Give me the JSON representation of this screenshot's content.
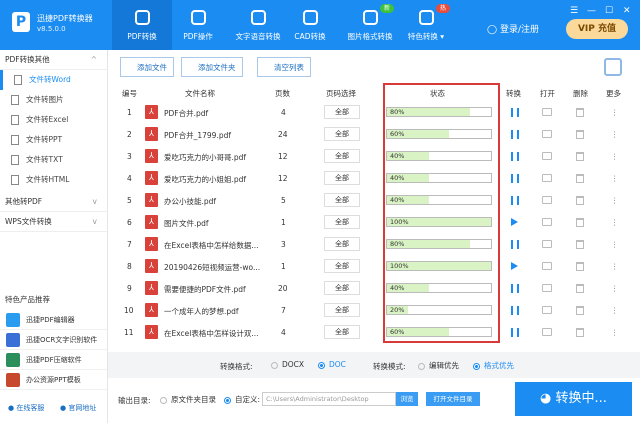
{
  "app": {
    "name": "迅捷PDF转换器",
    "version": "v8.5.0.0"
  },
  "nav": [
    {
      "label": "PDF转换",
      "icon": "convert-icon"
    },
    {
      "label": "PDF操作",
      "icon": "disc-icon"
    },
    {
      "label": "文字语音转换",
      "icon": "audio-icon"
    },
    {
      "label": "CAD转换",
      "icon": "cad-icon"
    },
    {
      "label": "图片格式转换",
      "icon": "image-icon",
      "badge": "新"
    },
    {
      "label": "特色转换 ▾",
      "icon": "star-icon",
      "badge": "热"
    }
  ],
  "header": {
    "login": "登录/注册",
    "vip": "VIP 充值",
    "menu": "☰",
    "minimize": "—",
    "maximize": "☐",
    "close": "✕"
  },
  "sidebar": {
    "group1": "PDF转换其他",
    "items": [
      "文件转Word",
      "文件转图片",
      "文件转Excel",
      "文件转PPT",
      "文件转TXT",
      "文件转HTML"
    ],
    "group2": "其他转PDF",
    "group3": "WPS文件转换",
    "featured_title": "特色产品推荐",
    "products": [
      "迅捷PDF编辑器",
      "迅捷OCR文字识别软件",
      "迅捷PDF压缩软件",
      "办公资源PPT模板"
    ],
    "service": "在线客服",
    "website": "官网地址"
  },
  "toolbar": {
    "add_file": "添加文件",
    "add_folder": "添加文件夹",
    "clear": "清空列表"
  },
  "table": {
    "headers": {
      "index": "编号",
      "name": "文件名称",
      "pages": "页数",
      "range": "页码选择",
      "status": "状态",
      "convert": "转换",
      "open": "打开",
      "delete": "删除",
      "more": "更多"
    },
    "rows": [
      {
        "index": "1",
        "name": "PDF合并.pdf",
        "pages": "4",
        "range": "全部",
        "progress": 80,
        "label": "80%",
        "state": "pause"
      },
      {
        "index": "2",
        "name": "PDF合并_1799.pdf",
        "pages": "24",
        "range": "全部",
        "progress": 60,
        "label": "60%",
        "state": "pause"
      },
      {
        "index": "3",
        "name": "爱吃巧克力的小哥哥.pdf",
        "pages": "12",
        "range": "全部",
        "progress": 40,
        "label": "40%",
        "state": "pause"
      },
      {
        "index": "4",
        "name": "爱吃巧克力的小姐姐.pdf",
        "pages": "12",
        "range": "全部",
        "progress": 40,
        "label": "40%",
        "state": "pause"
      },
      {
        "index": "5",
        "name": "办公小技能.pdf",
        "pages": "5",
        "range": "全部",
        "progress": 40,
        "label": "40%",
        "state": "pause"
      },
      {
        "index": "6",
        "name": "图片文件.pdf",
        "pages": "1",
        "range": "全部",
        "progress": 100,
        "label": "100%",
        "state": "play"
      },
      {
        "index": "7",
        "name": "在Excel表格中怎样给数据...",
        "pages": "3",
        "range": "全部",
        "progress": 80,
        "label": "80%",
        "state": "pause"
      },
      {
        "index": "8",
        "name": "20190426短视频运营-wo...",
        "pages": "1",
        "range": "全部",
        "progress": 100,
        "label": "100%",
        "state": "play"
      },
      {
        "index": "9",
        "name": "需要便捷的PDF文件.pdf",
        "pages": "20",
        "range": "全部",
        "progress": 40,
        "label": "40%",
        "state": "pause"
      },
      {
        "index": "10",
        "name": "一个成年人的梦想.pdf",
        "pages": "7",
        "range": "全部",
        "progress": 20,
        "label": "20%",
        "state": "pause"
      },
      {
        "index": "11",
        "name": "在Excel表格中怎样设计双...",
        "pages": "4",
        "range": "全部",
        "progress": 60,
        "label": "60%",
        "state": "pause"
      }
    ]
  },
  "options": {
    "format_label": "转换格式:",
    "docx": "DOCX",
    "doc": "DOC",
    "format_selected": "DOC",
    "mode_label": "转换模式:",
    "edit_first": "编辑优先",
    "format_first": "格式优先",
    "mode_selected": "格式优先"
  },
  "output": {
    "label": "输出目录:",
    "source": "原文件夹目录",
    "custom": "自定义:",
    "path": "C:\\Users\\Administrator\\Desktop",
    "browse": "浏览",
    "open_dir": "打开文件目录",
    "convert": "转换中..."
  },
  "colors": {
    "primary": "#1b8cf2",
    "highlight": "#d83a3a",
    "progress": "#d9f3c4",
    "pdf": "#d9423a"
  }
}
